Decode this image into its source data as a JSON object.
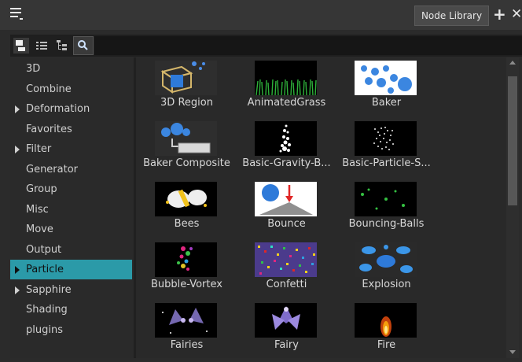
{
  "panel": {
    "tab_label": "Node Library",
    "add_glyph": "+",
    "close_glyph": "✕",
    "menu_icon": "hamburger-icon"
  },
  "toolbar": {
    "search_value": "",
    "search_icon": "search-icon",
    "thumbnail_view_icon": "thumbnail-view-icon",
    "list_view_icon": "list-view-icon",
    "tree_view_icon": "tree-view-icon"
  },
  "categories": [
    {
      "label": "3D",
      "expandable": false,
      "selected": false
    },
    {
      "label": "Combine",
      "expandable": false,
      "selected": false
    },
    {
      "label": "Deformation",
      "expandable": true,
      "selected": false
    },
    {
      "label": "Favorites",
      "expandable": false,
      "selected": false
    },
    {
      "label": "Filter",
      "expandable": true,
      "selected": false
    },
    {
      "label": "Generator",
      "expandable": false,
      "selected": false
    },
    {
      "label": "Group",
      "expandable": false,
      "selected": false
    },
    {
      "label": "Misc",
      "expandable": false,
      "selected": false
    },
    {
      "label": "Move",
      "expandable": false,
      "selected": false
    },
    {
      "label": "Output",
      "expandable": false,
      "selected": false
    },
    {
      "label": "Particle",
      "expandable": true,
      "selected": true
    },
    {
      "label": "Sapphire",
      "expandable": true,
      "selected": false
    },
    {
      "label": "Shading",
      "expandable": false,
      "selected": false
    },
    {
      "label": "plugins",
      "expandable": false,
      "selected": false
    }
  ],
  "nodes": [
    {
      "label": "3D Region",
      "icon": "3d-region-icon"
    },
    {
      "label": "AnimatedGrass",
      "icon": "animated-grass-icon"
    },
    {
      "label": "Baker",
      "icon": "baker-icon"
    },
    {
      "label": "Baker Composite",
      "icon": "baker-composite-icon"
    },
    {
      "label": "Basic-Gravity-B...",
      "icon": "basic-gravity-icon"
    },
    {
      "label": "Basic-Particle-S...",
      "icon": "basic-particle-icon"
    },
    {
      "label": "Bees",
      "icon": "bees-icon"
    },
    {
      "label": "Bounce",
      "icon": "bounce-icon"
    },
    {
      "label": "Bouncing-Balls",
      "icon": "bouncing-balls-icon"
    },
    {
      "label": "Bubble-Vortex",
      "icon": "bubble-vortex-icon"
    },
    {
      "label": "Confetti",
      "icon": "confetti-icon"
    },
    {
      "label": "Explosion",
      "icon": "explosion-icon"
    },
    {
      "label": "Fairies",
      "icon": "fairies-icon"
    },
    {
      "label": "Fairy",
      "icon": "fairy-icon"
    },
    {
      "label": "Fire",
      "icon": "fire-icon"
    }
  ],
  "colors": {
    "selection": "#2b9aa8",
    "panel_bg": "#2b2b2b"
  }
}
